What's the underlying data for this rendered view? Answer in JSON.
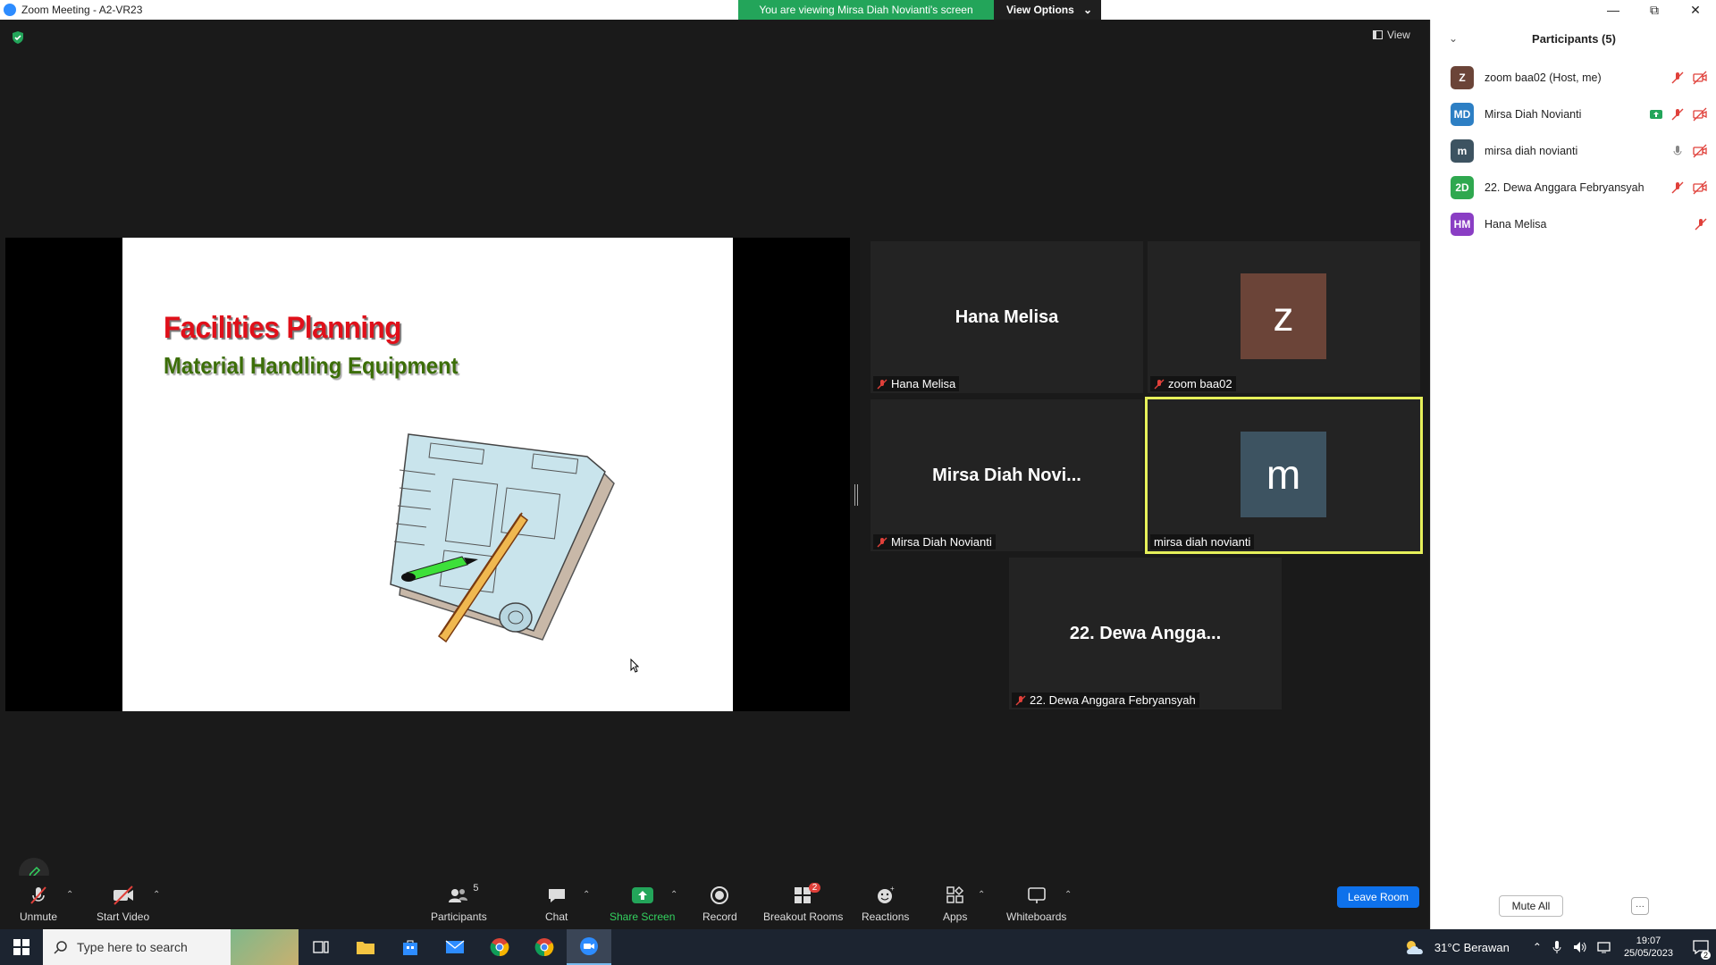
{
  "window": {
    "title": "Zoom Meeting - A2-VR23"
  },
  "banner": {
    "message": "You are viewing Mirsa Diah Novianti's screen",
    "view_options": "View Options"
  },
  "view_label": "View",
  "slide": {
    "title": "Facilities Planning",
    "subtitle": "Material Handling Equipment"
  },
  "tiles": [
    {
      "big": "Hana Melisa",
      "label": "Hana Melisa"
    },
    {
      "avatar": "z",
      "avatar_color": "#6b4438",
      "label": "zoom baa02"
    },
    {
      "big": "Mirsa  Diah  Novi...",
      "label": "Mirsa Diah Novianti"
    },
    {
      "avatar": "m",
      "avatar_color": "#3d5361",
      "label": "mirsa diah novianti"
    },
    {
      "big": "22.  Dewa  Angga...",
      "label": "22. Dewa Anggara Febryansyah"
    }
  ],
  "toolbar": {
    "unmute": "Unmute",
    "start_video": "Start Video",
    "participants": "Participants",
    "participants_count": "5",
    "chat": "Chat",
    "share_screen": "Share Screen",
    "record": "Record",
    "breakout": "Breakout Rooms",
    "breakout_badge": "2",
    "reactions": "Reactions",
    "apps": "Apps",
    "whiteboards": "Whiteboards",
    "leave": "Leave Room"
  },
  "panel": {
    "title": "Participants (5)",
    "participants": [
      {
        "initials": "Z",
        "color": "#6b4438",
        "name": "zoom baa02 (Host, me)"
      },
      {
        "initials": "MD",
        "color": "#2d7fc4",
        "name": "Mirsa Diah Novianti"
      },
      {
        "initials": "m",
        "color": "#3d5361",
        "name": "mirsa diah novianti"
      },
      {
        "initials": "2D",
        "color": "#2fa84f",
        "name": "22. Dewa Anggara Febryansyah"
      },
      {
        "initials": "HM",
        "color": "#8a3ec4",
        "name": "Hana Melisa"
      }
    ],
    "mute_all": "Mute All",
    "more": "···"
  },
  "taskbar": {
    "search_placeholder": "Type here to search",
    "weather": "31°C  Berawan",
    "time": "19:07",
    "date": "25/05/2023",
    "notification_count": "2"
  },
  "colors": {
    "accent": "#0e71eb",
    "green": "#23a55a",
    "active_border": "#e6f05a",
    "muted_red": "#e0403a"
  }
}
